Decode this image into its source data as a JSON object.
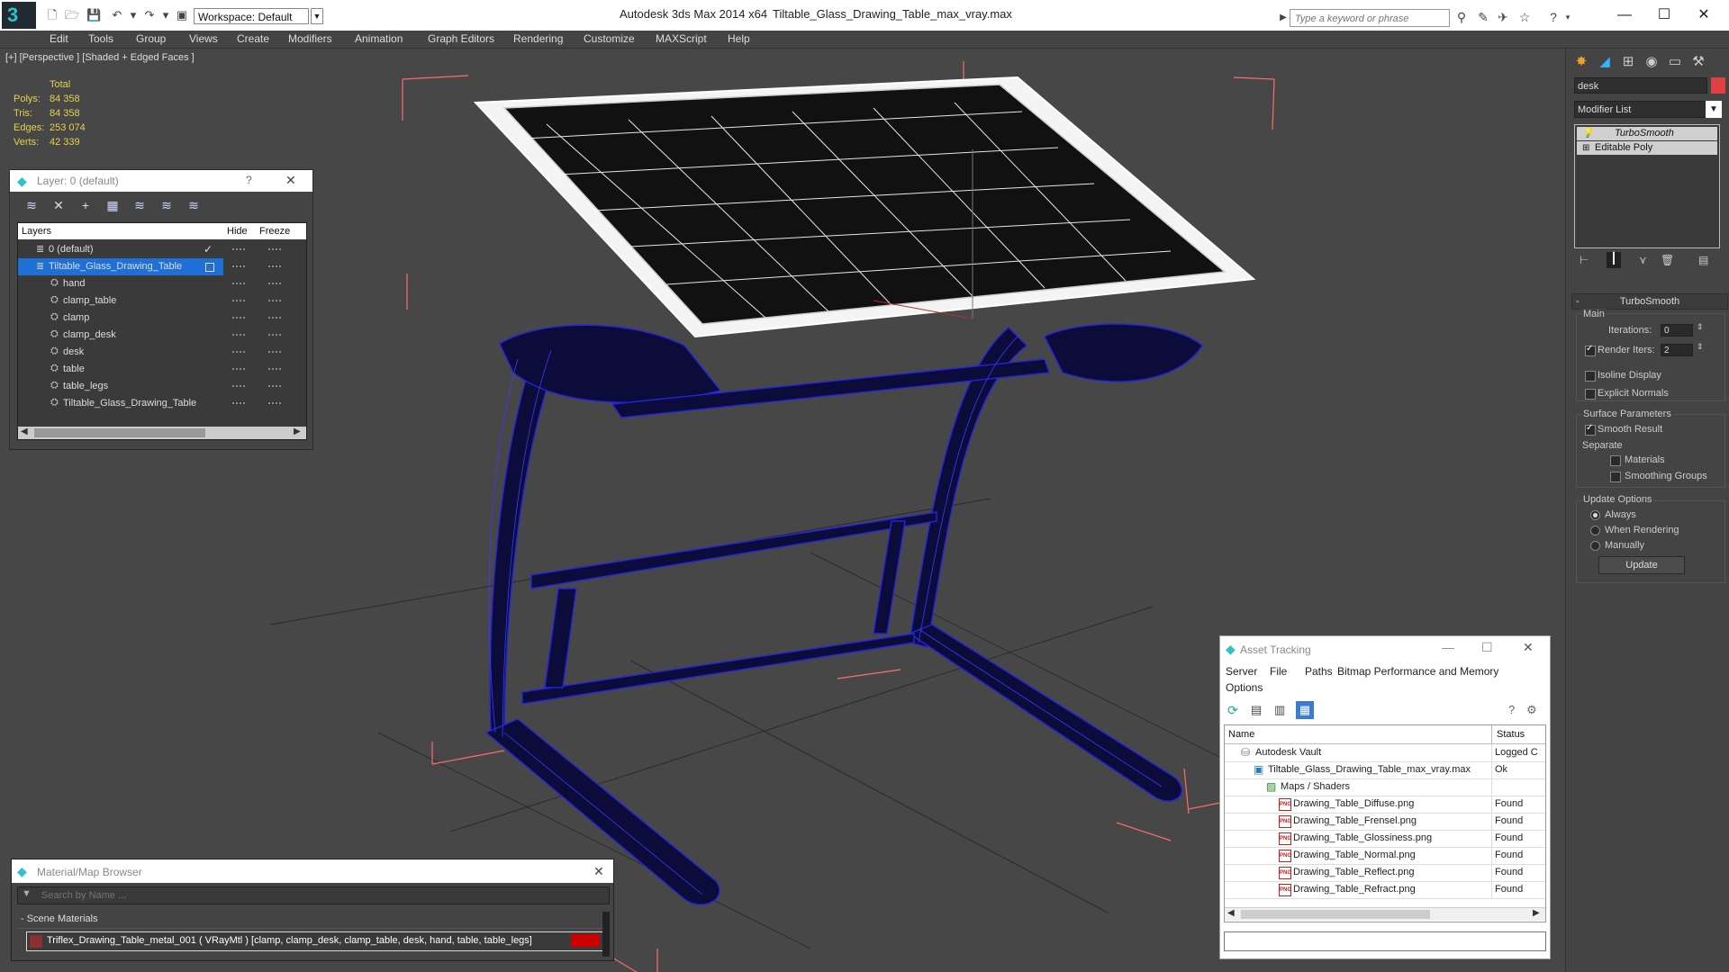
{
  "app": {
    "title": "Autodesk 3ds Max  2014 x64",
    "document": "Tiltable_Glass_Drawing_Table_max_vray.max",
    "workspace": "Workspace: Default",
    "search_placeholder": "Type a keyword or phrase"
  },
  "menu": [
    "Edit",
    "Tools",
    "Group",
    "Views",
    "Create",
    "Modifiers",
    "Animation",
    "Graph Editors",
    "Rendering",
    "Customize",
    "MAXScript",
    "Help"
  ],
  "viewport": {
    "label": "[+] [Perspective ] [Shaded + Edged Faces ]",
    "stats": {
      "header": "Total",
      "rows": [
        {
          "label": "Polys:",
          "value": "84 358"
        },
        {
          "label": "Tris:",
          "value": "84 358"
        },
        {
          "label": "Edges:",
          "value": "253 074"
        },
        {
          "label": "Verts:",
          "value": "42 339"
        }
      ]
    }
  },
  "layer_panel": {
    "title": "Layer: 0 (default)",
    "help": "?",
    "columns": {
      "layers": "Layers",
      "hide": "Hide",
      "freeze": "Freeze"
    },
    "rows": [
      {
        "name": "0 (default)",
        "level": 1,
        "selected": false
      },
      {
        "name": "Tiltable_Glass_Drawing_Table",
        "level": 1,
        "selected": true
      },
      {
        "name": "hand",
        "level": 2,
        "selected": false
      },
      {
        "name": "clamp_table",
        "level": 2,
        "selected": false
      },
      {
        "name": "clamp",
        "level": 2,
        "selected": false
      },
      {
        "name": "clamp_desk",
        "level": 2,
        "selected": false
      },
      {
        "name": "desk",
        "level": 2,
        "selected": false
      },
      {
        "name": "table",
        "level": 2,
        "selected": false
      },
      {
        "name": "table_legs",
        "level": 2,
        "selected": false
      },
      {
        "name": "Tiltable_Glass_Drawing_Table",
        "level": 2,
        "selected": false
      }
    ]
  },
  "command_panel": {
    "object_name": "desk",
    "object_color": "#e04040",
    "modifier_list": "Modifier List",
    "stack": [
      "TurboSmooth",
      "Editable Poly"
    ],
    "rollout": "TurboSmooth",
    "main": "Main",
    "iterations_label": "Iterations:",
    "iterations": "0",
    "render_iters_label": "Render Iters:",
    "render_iters": "2",
    "render_iters_checked": true,
    "isoline": "Isoline Display",
    "explicit_normals": "Explicit Normals",
    "surface_params": "Surface Parameters",
    "smooth_result": "Smooth Result",
    "smooth_result_checked": true,
    "separate": "Separate",
    "materials": "Materials",
    "smoothing_groups": "Smoothing Groups",
    "update_options": "Update Options",
    "radio_always": "Always",
    "radio_when_rendering": "When Rendering",
    "radio_manually": "Manually",
    "selected_update": "Always",
    "update_button": "Update"
  },
  "asset_tracking": {
    "title": "Asset Tracking",
    "menu": [
      "Server",
      "File",
      "Paths",
      "Bitmap Performance and Memory"
    ],
    "menu2": "Options",
    "columns": {
      "name": "Name",
      "status": "Status"
    },
    "rows": [
      {
        "name": "Autodesk Vault",
        "status": "Logged C",
        "indent": 1,
        "icon": "vault"
      },
      {
        "name": "Tiltable_Glass_Drawing_Table_max_vray.max",
        "status": "Ok",
        "indent": 2,
        "icon": "max"
      },
      {
        "name": "Maps / Shaders",
        "status": "",
        "indent": 3,
        "icon": "maps"
      },
      {
        "name": "Drawing_Table_Diffuse.png",
        "status": "Found",
        "indent": 4,
        "icon": "png"
      },
      {
        "name": "Drawing_Table_Frensel.png",
        "status": "Found",
        "indent": 4,
        "icon": "png"
      },
      {
        "name": "Drawing_Table_Glossiness.png",
        "status": "Found",
        "indent": 4,
        "icon": "png"
      },
      {
        "name": "Drawing_Table_Normal.png",
        "status": "Found",
        "indent": 4,
        "icon": "png"
      },
      {
        "name": "Drawing_Table_Reflect.png",
        "status": "Found",
        "indent": 4,
        "icon": "png"
      },
      {
        "name": "Drawing_Table_Refract.png",
        "status": "Found",
        "indent": 4,
        "icon": "png"
      }
    ],
    "png_label": "PNG"
  },
  "material_browser": {
    "title": "Material/Map Browser",
    "search_placeholder": "Search by Name ...",
    "group": "- Scene Materials",
    "material": "Triflex_Drawing_Table_metal_001  ( VRayMtl ) [clamp, clamp_desk, clamp_table, desk, hand, table, table_legs]"
  },
  "colors": {
    "selection": "#1e6fd6",
    "stats": "#e6d34a",
    "wire_blue": "#1a1aff",
    "bbox": "#ff6a6a"
  }
}
